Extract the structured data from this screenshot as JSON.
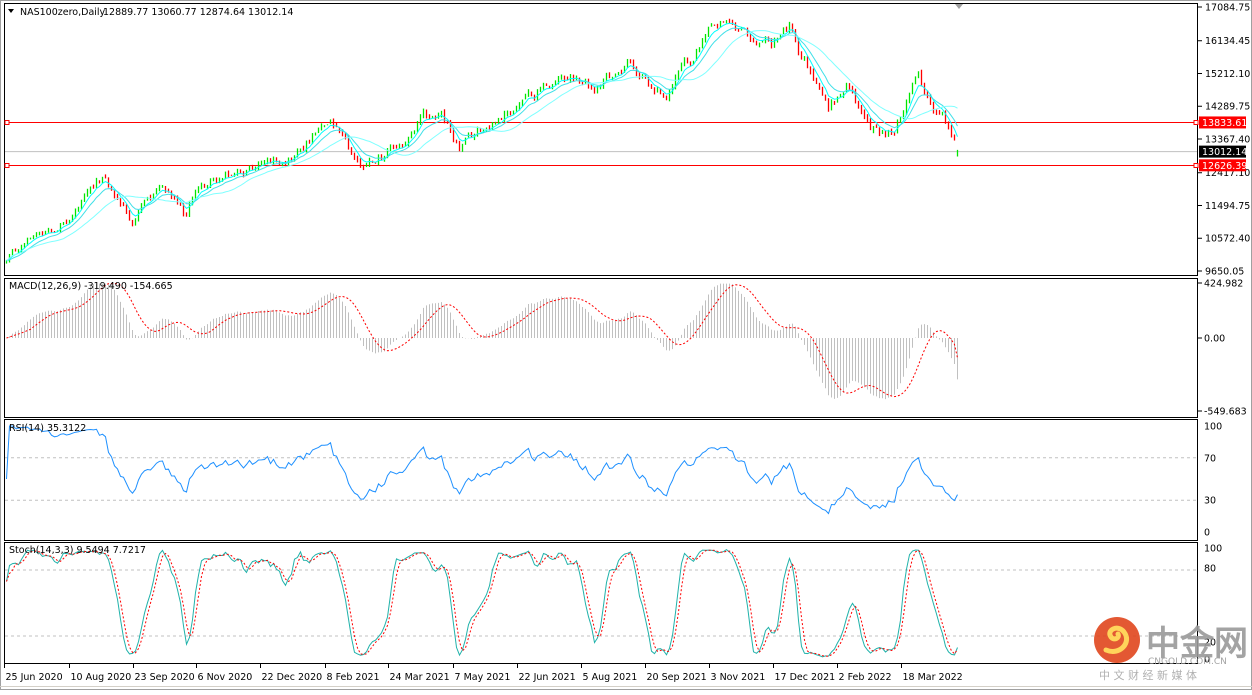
{
  "window": {
    "frame_color": "#d4d0c8"
  },
  "header": {
    "symbol_label": "NAS100zero,Daily",
    "ohlc": "12889.77 13060.77 12874.64 13012.14",
    "menu_icon": "triangle-down-icon"
  },
  "colors": {
    "bull_bar": "#00e600",
    "bear_bar": "#ff0000",
    "ma_lines": [
      "#00ffff",
      "#40e0e8",
      "#7fffff"
    ],
    "level_line": "#ff0000",
    "bid_line": "#c0c0c0",
    "macd_hist": "#c0c0c0",
    "macd_signal": "#ff0000",
    "rsi": "#1e90ff",
    "stoch_main": "#20b2aa",
    "stoch_signal": "#ff0000"
  },
  "price_axis": {
    "labels": [
      "17084.75",
      "16134.45",
      "15212.10",
      "14289.75",
      "13367.40",
      "12417.10",
      "11494.75",
      "10572.40",
      "9650.05"
    ],
    "levels": [
      {
        "value": 13833.61,
        "label": "13833.61",
        "type": "horizontal-line"
      },
      {
        "value": 12626.39,
        "label": "12626.39",
        "type": "horizontal-line"
      }
    ],
    "bid": {
      "value": 13012.14,
      "label": "13012.14"
    }
  },
  "date_axis": {
    "labels": [
      "25 Jun 2020",
      "10 Aug 2020",
      "23 Sep 2020",
      "6 Nov 2020",
      "22 Dec 2020",
      "8 Feb 2021",
      "24 Mar 2021",
      "7 May 2021",
      "22 Jun 2021",
      "5 Aug 2021",
      "20 Sep 2021",
      "3 Nov 2021",
      "17 Dec 2021",
      "2 Feb 2022",
      "18 Mar 2022"
    ]
  },
  "indicators": {
    "macd": {
      "label": "MACD(12,26,9) -319.490 -154.665",
      "axis": [
        "424.982",
        "0.00",
        "-549.683"
      ]
    },
    "rsi": {
      "label": "RSI(14) 35.3122",
      "axis": [
        "100",
        "70",
        "30",
        "0"
      ]
    },
    "stoch": {
      "label": "Stoch(14,3,3) 9.5494 7.7217",
      "axis": [
        "100",
        "80",
        "20",
        "0"
      ]
    }
  },
  "watermark": {
    "brand": "中金网",
    "domain": "CNGOLD.COM.CN",
    "tagline": "中 文 财 经 新 媒 体"
  },
  "chart_data": {
    "type": "ohlc-bar",
    "symbol": "NAS100zero",
    "timeframe": "Daily",
    "ylim": [
      9650.05,
      17084.75
    ],
    "last_bar": {
      "open": 12889.77,
      "high": 13060.77,
      "low": 12874.64,
      "close": 13012.14
    },
    "close_path": [
      {
        "date": "2020-06-25",
        "close": 9900
      },
      {
        "date": "2020-07-17",
        "close": 10750
      },
      {
        "date": "2020-08-10",
        "close": 11100
      },
      {
        "date": "2020-09-02",
        "close": 12270
      },
      {
        "date": "2020-09-23",
        "close": 11050
      },
      {
        "date": "2020-10-12",
        "close": 12050
      },
      {
        "date": "2020-10-30",
        "close": 11200
      },
      {
        "date": "2020-11-06",
        "close": 11950
      },
      {
        "date": "2020-11-30",
        "close": 12300
      },
      {
        "date": "2020-12-22",
        "close": 12700
      },
      {
        "date": "2021-01-15",
        "close": 12950
      },
      {
        "date": "2021-02-12",
        "close": 13800
      },
      {
        "date": "2021-03-04",
        "close": 12600
      },
      {
        "date": "2021-03-24",
        "close": 13000
      },
      {
        "date": "2021-04-06",
        "close": 13300
      },
      {
        "date": "2021-04-16",
        "close": 13950
      },
      {
        "date": "2021-04-29",
        "close": 14000
      },
      {
        "date": "2021-05-12",
        "close": 13100
      },
      {
        "date": "2021-05-28",
        "close": 13700
      },
      {
        "date": "2021-06-22",
        "close": 14300
      },
      {
        "date": "2021-07-12",
        "close": 14900
      },
      {
        "date": "2021-07-30",
        "close": 15150
      },
      {
        "date": "2021-08-18",
        "close": 14950
      },
      {
        "date": "2021-09-07",
        "close": 15600
      },
      {
        "date": "2021-09-20",
        "close": 15000
      },
      {
        "date": "2021-10-04",
        "close": 14600
      },
      {
        "date": "2021-10-15",
        "close": 15300
      },
      {
        "date": "2021-11-03",
        "close": 16300
      },
      {
        "date": "2021-11-19",
        "close": 16600
      },
      {
        "date": "2021-12-01",
        "close": 16100
      },
      {
        "date": "2021-12-17",
        "close": 16150
      },
      {
        "date": "2021-12-28",
        "close": 16500
      },
      {
        "date": "2022-01-05",
        "close": 15800
      },
      {
        "date": "2022-01-13",
        "close": 15400
      },
      {
        "date": "2022-01-27",
        "close": 14300
      },
      {
        "date": "2022-02-09",
        "close": 14800
      },
      {
        "date": "2022-02-24",
        "close": 13700
      },
      {
        "date": "2022-03-14",
        "close": 13500
      },
      {
        "date": "2022-03-24",
        "close": 14800
      },
      {
        "date": "2022-03-29",
        "close": 15100
      },
      {
        "date": "2022-04-08",
        "close": 14300
      },
      {
        "date": "2022-04-20",
        "close": 13800
      },
      {
        "date": "2022-04-26",
        "close": 13012.14
      }
    ],
    "macd": {
      "params": [
        12,
        26,
        9
      ],
      "main_last": -319.49,
      "signal_last": -154.665,
      "ylim": [
        -549.683,
        424.982
      ]
    },
    "rsi": {
      "period": 14,
      "last": 35.3122,
      "levels": [
        30,
        70
      ],
      "ylim": [
        0,
        100
      ]
    },
    "stoch": {
      "params": [
        14,
        3,
        3
      ],
      "main_last": 9.5494,
      "signal_last": 7.7217,
      "levels": [
        20,
        80
      ],
      "ylim": [
        0,
        100
      ]
    }
  }
}
